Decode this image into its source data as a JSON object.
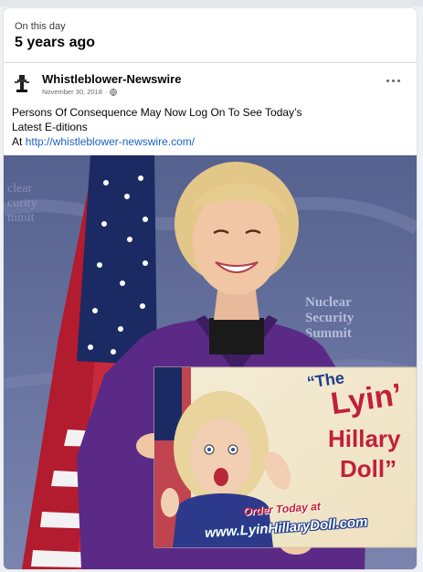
{
  "on_this_day": {
    "label": "On this day",
    "title": "5 years ago"
  },
  "post": {
    "author": "Whistleblower-Newswire",
    "date": "November 30, 2018",
    "date_separator": "·",
    "privacy_icon": "globe-icon",
    "more_icon": "more-options-icon",
    "text_line1": "Persons Of Consequence May Now Log On To See Today’s",
    "text_line2": "Latest E-ditions",
    "text_prefix": "At",
    "link": "http://whistleblower-newswire.com/"
  },
  "photo": {
    "backdrop_text": [
      "Nuclear",
      "Security",
      "Summit"
    ],
    "sign": {
      "title_open": "“The",
      "word1": "Lyin’",
      "word2": "Hillary",
      "word3": "Doll”",
      "order_line": "Order Today at",
      "url": "www.LyinHillaryDoll.com"
    }
  },
  "colors": {
    "link": "#1a62c9",
    "sign_red": "#c21f3a",
    "sign_blue": "#1f3c8a",
    "jacket": "#5a2a86"
  }
}
